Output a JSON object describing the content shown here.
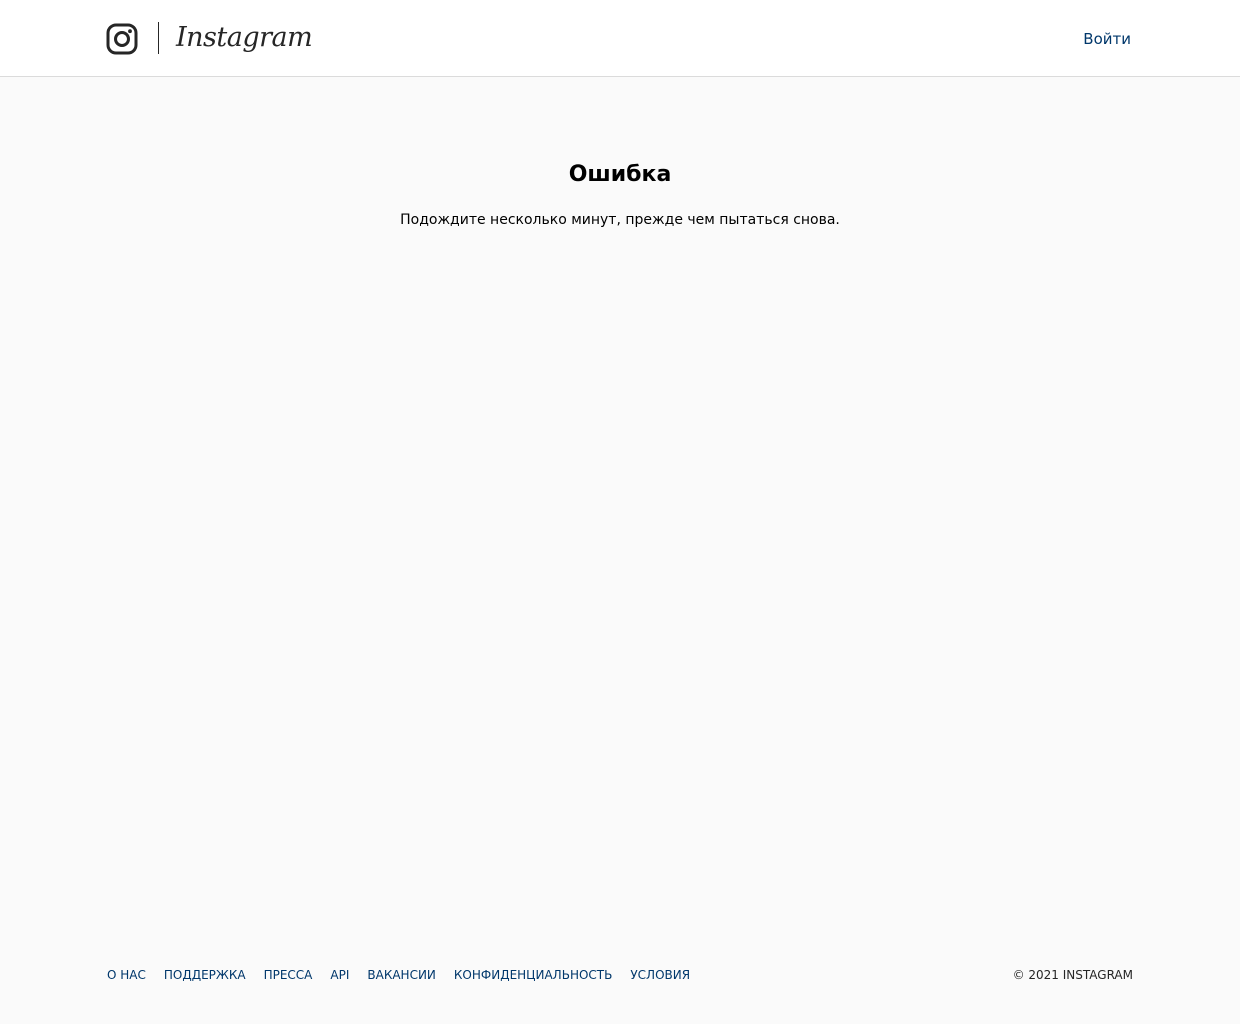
{
  "header": {
    "logo_icon": "instagram-camera-icon",
    "wordmark": "Instagram",
    "login_label": "Войти"
  },
  "main": {
    "title": "Ошибка",
    "message": "Подождите несколько минут, прежде чем пытаться снова."
  },
  "footer": {
    "links": [
      {
        "label": "О НАС"
      },
      {
        "label": "ПОДДЕРЖКА"
      },
      {
        "label": "ПРЕССА"
      },
      {
        "label": "API"
      },
      {
        "label": "ВАКАНСИИ"
      },
      {
        "label": "КОНФИДЕНЦИАЛЬНОСТЬ"
      },
      {
        "label": "УСЛОВИЯ"
      }
    ],
    "copyright": "© 2021 INSTAGRAM"
  },
  "colors": {
    "background": "#fafafa",
    "header_bg": "#ffffff",
    "link": "#00376b",
    "text": "#262626"
  }
}
